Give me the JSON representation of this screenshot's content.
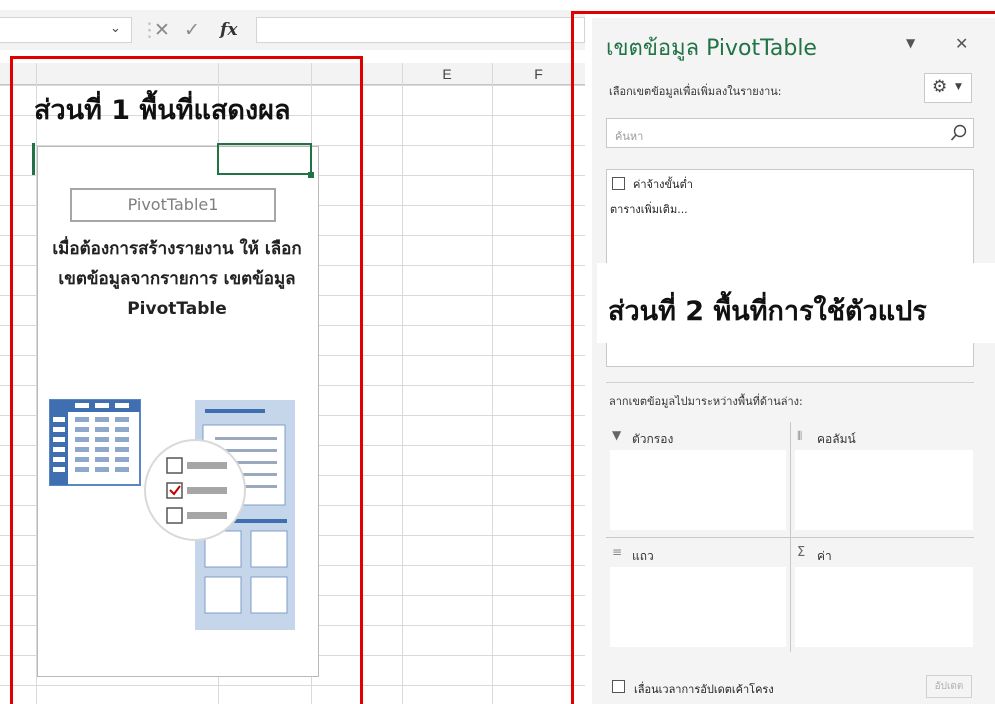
{
  "formula_bar": {
    "name_box_dropdown": "⌄",
    "cancel_icon": "✕",
    "enter_icon": "✓",
    "function_icon": "fx",
    "formula_value": ""
  },
  "columns": [
    "E",
    "F"
  ],
  "left_panel": {
    "callout": "ส่วนที่ 1 พื้นที่แสดงผล",
    "pivot_name": "PivotTable1",
    "message": "เมื่อต้องการสร้างรายงาน ให้ เลือกเขตข้อมูลจากรายการ เขตข้อมูล PivotTable"
  },
  "pane": {
    "title": "เขตข้อมูล PivotTable",
    "subtitle": "เลือกเขตข้อมูลเพื่อเพิ่มลงในรายงาน:",
    "search_placeholder": "ค้นหา",
    "fields": [
      {
        "label": "ค่าจ้างขั้นต่ำ",
        "checked": false
      }
    ],
    "more_tables": "ตารางเพิ่มเติม...",
    "callout": "ส่วนที่ 2 พื้นที่การใช้ตัวแปร",
    "drag_hint": "ลากเขตข้อมูลไปมาระหว่างพื้นที่ด้านล่าง:",
    "areas": {
      "filters": "ตัวกรอง",
      "columns": "คอลัมน์",
      "rows": "แถว",
      "values": "ค่า"
    },
    "defer_label": "เลื่อนเวลาการอัปเดตเค้าโครง",
    "update_button": "อัปเดต"
  },
  "colors": {
    "accent_green": "#217346",
    "callout_red": "#e00000",
    "illustration_blue": "#3f6fb0"
  }
}
